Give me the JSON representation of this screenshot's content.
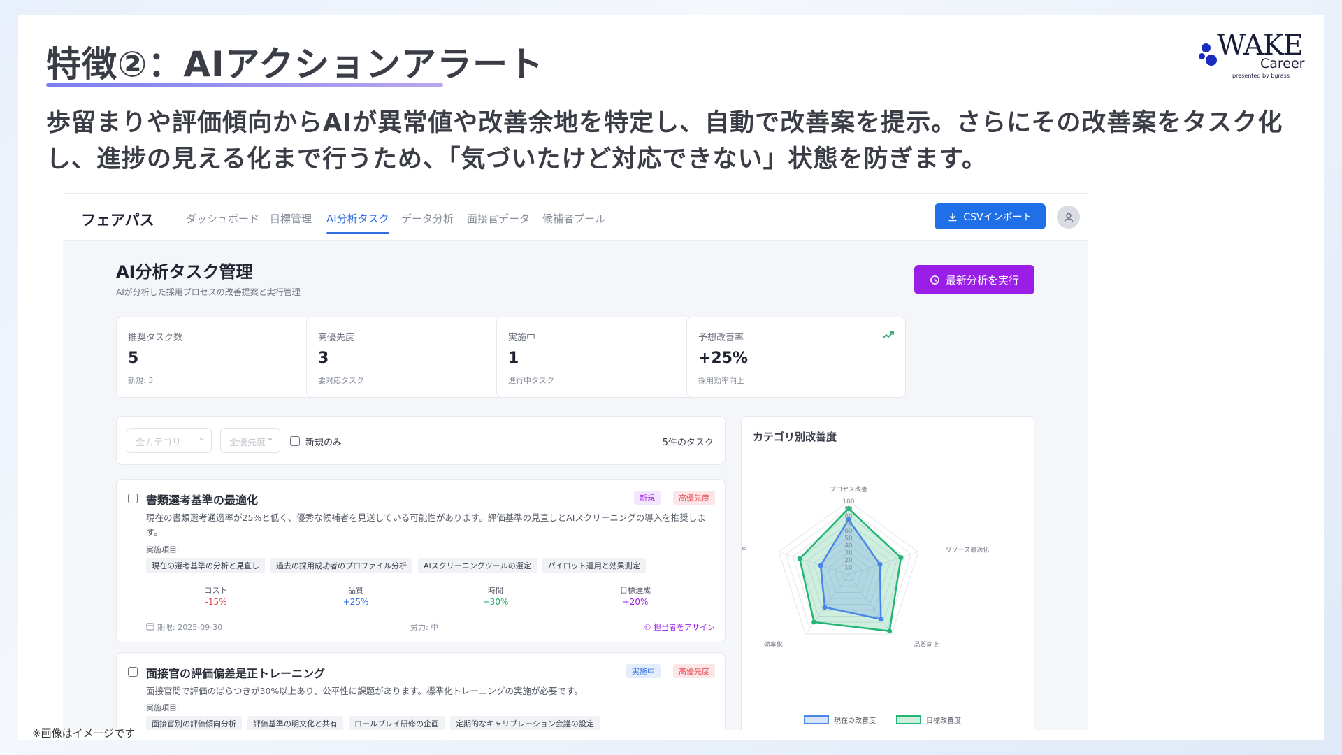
{
  "slide": {
    "title": "特徴②：AIアクションアラート",
    "lead": "歩留まりや評価傾向からAIが異常値や改善余地を特定し、自動で改善案を提示。さらにその改善案をタスク化し、進捗の見える化まで行うため、「気づいたけど対応できない」状態を防ぎます。",
    "note": "※画像はイメージです"
  },
  "logo": {
    "wake": "WAKE",
    "career": "Career",
    "presented": "presented by bgrass"
  },
  "app": {
    "brand": "フェアパス",
    "nav": [
      "ダッシュボード",
      "目標管理",
      "AI分析タスク",
      "データ分析",
      "面接官データ",
      "候補者プール"
    ],
    "csv_button": "CSVインポート",
    "page_title": "AI分析タスク管理",
    "page_subtitle": "AIが分析した採用プロセスの改善提案と実行管理",
    "run_button": "最新分析を実行",
    "stats": [
      {
        "label": "推奨タスク数",
        "value": "5",
        "sub": "新規: 3",
        "icon": "sparkle-icon",
        "color": "#8b3ce6"
      },
      {
        "label": "高優先度",
        "value": "3",
        "sub": "要対応タスク",
        "icon": "alert-circle-icon",
        "color": "#e5484d"
      },
      {
        "label": "実施中",
        "value": "1",
        "sub": "進行中タスク",
        "icon": "clock-icon",
        "color": "#2f6fe0"
      },
      {
        "label": "予想改善率",
        "value": "+25%",
        "sub": "採用効率向上",
        "icon": "trend-up-icon",
        "color": "#22a86a"
      }
    ],
    "filters": {
      "category_placeholder": "全カテゴリ",
      "priority_placeholder": "全優先度",
      "new_only": "新規のみ",
      "count": "5件のタスク"
    },
    "tasks": [
      {
        "title": "書類選考基準の最適化",
        "badges": [
          "新規",
          "高優先度"
        ],
        "desc": "現在の書類選考通過率が25%と低く、優秀な候補者を見送している可能性があります。評価基準の見直しとAIスクリーニングの導入を推奨します。",
        "items_label": "実施項目:",
        "items": [
          "現在の選考基準の分析と見直し",
          "過去の採用成功者のプロファイル分析",
          "AIスクリーニングツールの選定",
          "パイロット運用と効果測定"
        ],
        "metrics": [
          {
            "label": "コスト",
            "value": "-15%",
            "color": "#e5484d"
          },
          {
            "label": "品質",
            "value": "+25%",
            "color": "#2f6fe0"
          },
          {
            "label": "時間",
            "value": "+30%",
            "color": "#22a86a"
          },
          {
            "label": "目標達成",
            "value": "+20%",
            "color": "#9a1ee8"
          }
        ],
        "deadline": "期限: 2025-09-30",
        "effort": "労力: 中",
        "assign": "担当者をアサイン"
      },
      {
        "title": "面接官の評価偏差是正トレーニング",
        "badges": [
          "実施中",
          "高優先度"
        ],
        "desc": "面接官間で評価のばらつきが30%以上あり、公平性に課題があります。標準化トレーニングの実施が必要です。",
        "items_label": "実施項目:",
        "items": [
          "面接官別の評価傾向分析",
          "評価基準の明文化と共有",
          "ロールプレイ研修の企画",
          "定期的なキャリブレーション会議の設定"
        ]
      }
    ],
    "radar": {
      "title": "カテゴリ別改善度"
    }
  },
  "chart_data": {
    "type": "radar",
    "title": "カテゴリ別改善度",
    "categories": [
      "プロセス改善",
      "リソース最適化",
      "品質向上",
      "効率化",
      "多様性"
    ],
    "rmax": 100,
    "ticks": [
      10,
      20,
      30,
      40,
      50,
      60,
      70,
      80,
      90,
      100
    ],
    "series": [
      {
        "name": "現在の改善度",
        "values": [
          75,
          45,
          75,
          55,
          40
        ],
        "color": "#4a86e8"
      },
      {
        "name": "目標改善度",
        "values": [
          90,
          75,
          95,
          80,
          70
        ],
        "color": "#22b573"
      }
    ],
    "legend": "bottom"
  }
}
